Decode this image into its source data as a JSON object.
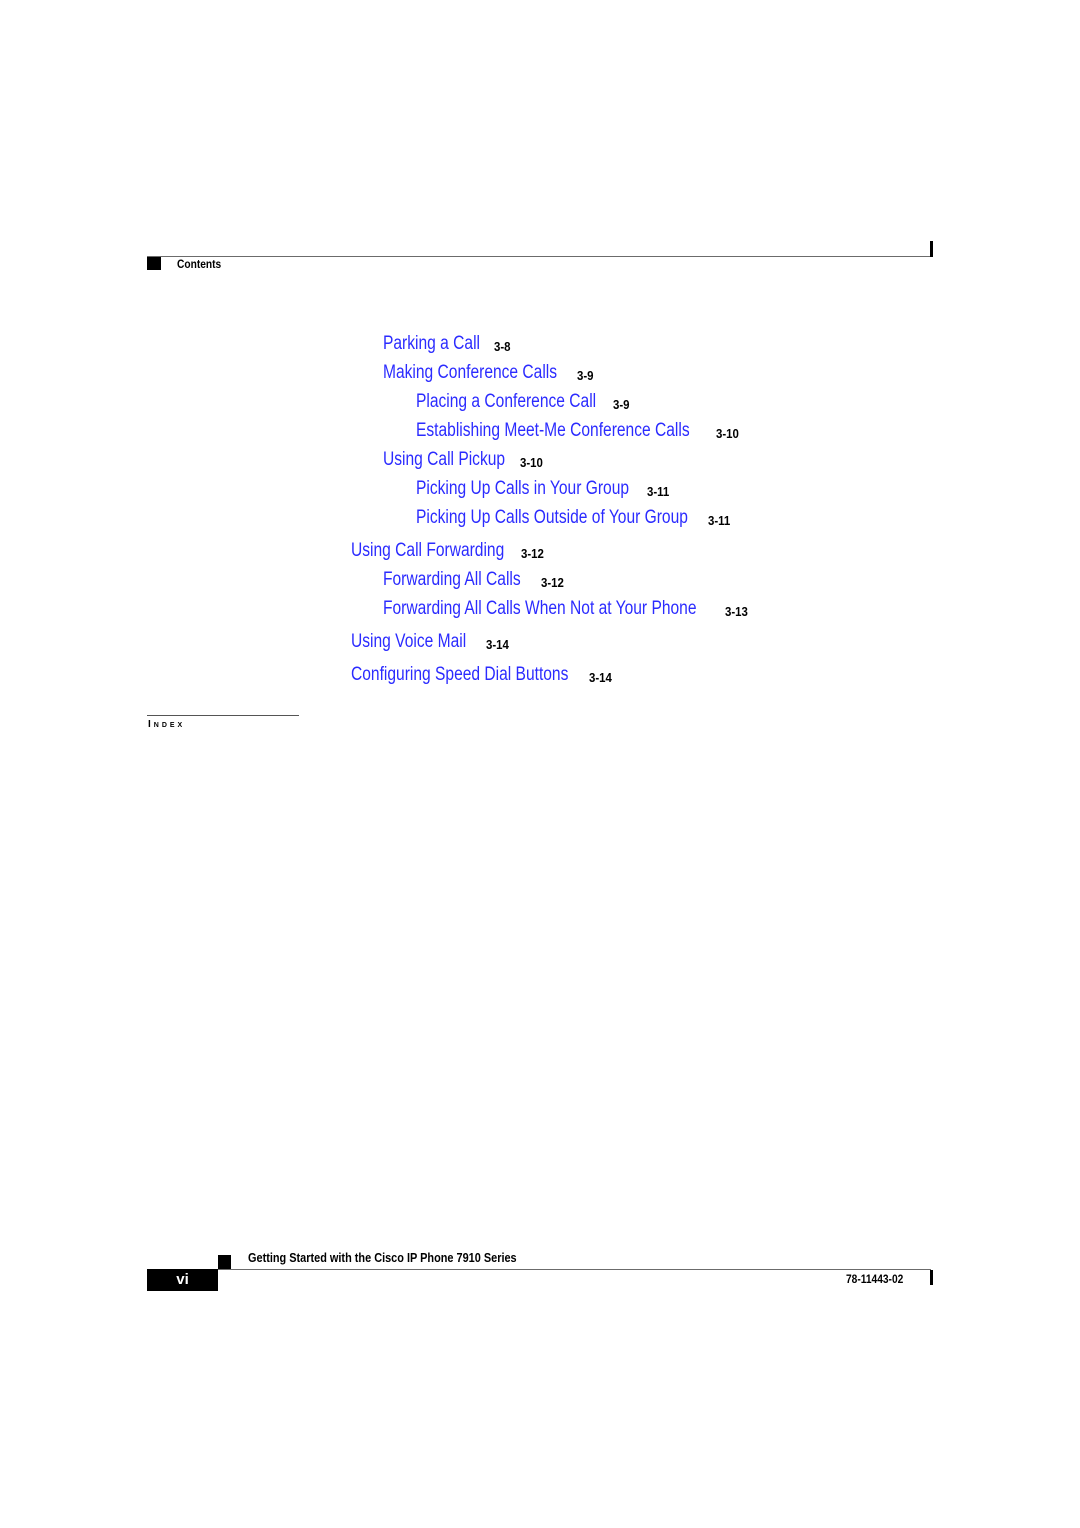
{
  "header": {
    "section_label": "Contents"
  },
  "toc": [
    {
      "title": "Parking a Call",
      "page": "3-8",
      "level": 2
    },
    {
      "title": "Making Conference Calls",
      "page": "3-9",
      "level": 2
    },
    {
      "title": "Placing a Conference Call",
      "page": "3-9",
      "level": 3
    },
    {
      "title": "Establishing Meet-Me Conference Calls",
      "page": "3-10",
      "level": 3
    },
    {
      "title": "Using Call Pickup",
      "page": "3-10",
      "level": 2
    },
    {
      "title": "Picking Up Calls in Your Group",
      "page": "3-11",
      "level": 3
    },
    {
      "title": "Picking Up Calls Outside of Your Group",
      "page": "3-11",
      "level": 3
    },
    {
      "title": "Using Call Forwarding",
      "page": "3-12",
      "level": 1
    },
    {
      "title": "Forwarding All Calls",
      "page": "3-12",
      "level": 2
    },
    {
      "title": "Forwarding All Calls When Not at Your Phone",
      "page": "3-13",
      "level": 2
    },
    {
      "title": "Using Voice Mail",
      "page": "3-14",
      "level": 1
    },
    {
      "title": "Configuring Speed Dial Buttons",
      "page": "3-14",
      "level": 1
    }
  ],
  "index_label": "Index",
  "footer": {
    "book_title": "Getting Started with the Cisco IP Phone 7910 Series",
    "page_number": "vi",
    "doc_number": "78-11443-02"
  }
}
